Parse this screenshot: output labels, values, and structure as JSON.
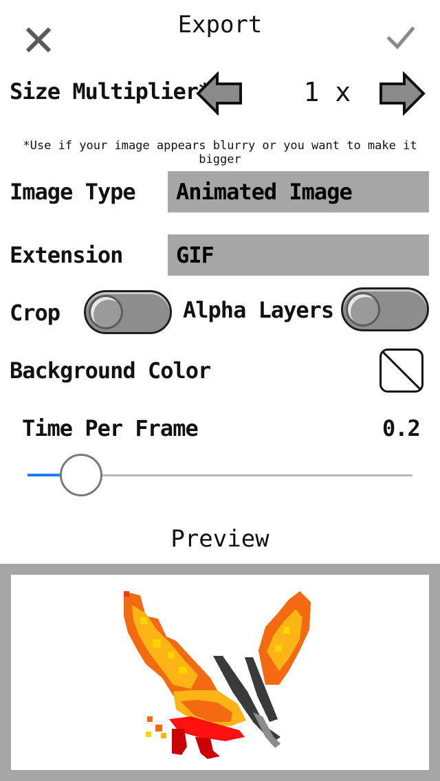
{
  "header": {
    "title": "Export",
    "close_icon": "close-icon",
    "confirm_icon": "checkmark-icon"
  },
  "size_multiplier": {
    "label": "Size Multiplier*",
    "value": "1 x",
    "decrease_icon": "arrow-left-icon",
    "increase_icon": "arrow-right-icon",
    "note": "*Use if your image appears blurry or you want to make it bigger"
  },
  "image_type": {
    "label": "Image Type",
    "value": "Animated Image"
  },
  "extension": {
    "label": "Extension",
    "value": "GIF"
  },
  "crop": {
    "label": "Crop",
    "on": false
  },
  "alpha_layers": {
    "label": "Alpha Layers",
    "on": false
  },
  "background_color": {
    "label": "Background Color",
    "value": "transparent",
    "icon": "no-color-icon"
  },
  "time_per_frame": {
    "label": "Time Per Frame",
    "value": "0.2",
    "slider_fraction": 0.14
  },
  "preview": {
    "title": "Preview",
    "image": "pixel-art-phoenix"
  },
  "colors": {
    "field_bg": "#a6a6a6",
    "slider_accent": "#1f7ce8",
    "toggle_off": "#8d8d8d"
  }
}
